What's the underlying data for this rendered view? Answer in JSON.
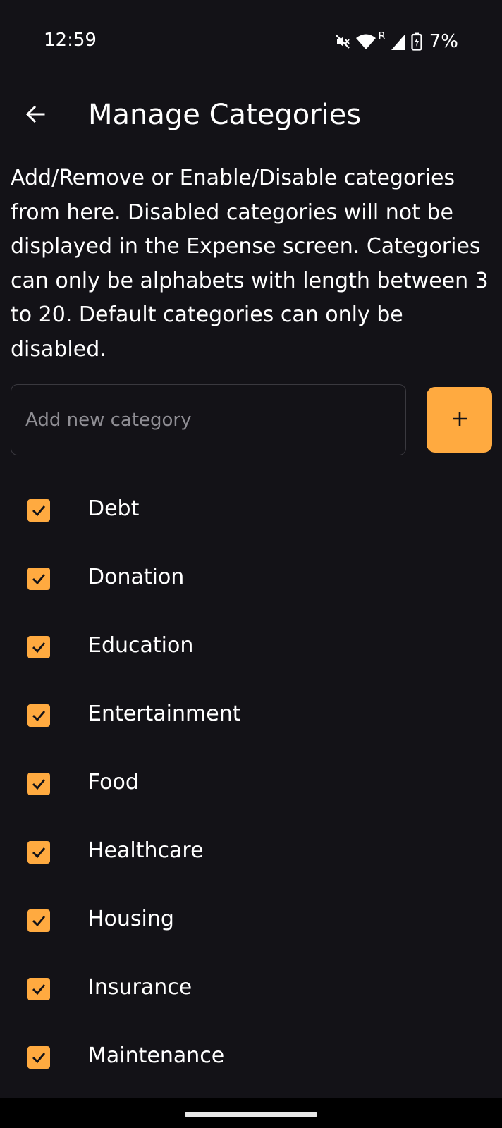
{
  "status_bar": {
    "time": "12:59",
    "battery": "7%",
    "icons": [
      "mute-icon",
      "wifi-icon",
      "signal-icon",
      "battery-charging-icon"
    ],
    "roaming": "R"
  },
  "app_bar": {
    "title": "Manage Categories",
    "back_icon": "arrow-left-icon"
  },
  "description": "Add/Remove or Enable/Disable categories from here. Disabled categories will not be displayed in the Expense screen. Categories can only be alphabets with length between 3 to 20. Default categories can only be disabled.",
  "add_category": {
    "placeholder": "Add new category",
    "value": "",
    "button_icon": "plus-icon"
  },
  "categories": [
    {
      "label": "Debt",
      "checked": true
    },
    {
      "label": "Donation",
      "checked": true
    },
    {
      "label": "Education",
      "checked": true
    },
    {
      "label": "Entertainment",
      "checked": true
    },
    {
      "label": "Food",
      "checked": true
    },
    {
      "label": "Healthcare",
      "checked": true
    },
    {
      "label": "Housing",
      "checked": true
    },
    {
      "label": "Insurance",
      "checked": true
    },
    {
      "label": "Maintenance",
      "checked": true
    }
  ],
  "colors": {
    "background": "#131217",
    "accent": "#ffaa40",
    "text": "#ffffff",
    "placeholder": "#8f8e94",
    "input_border": "#3a393f"
  }
}
